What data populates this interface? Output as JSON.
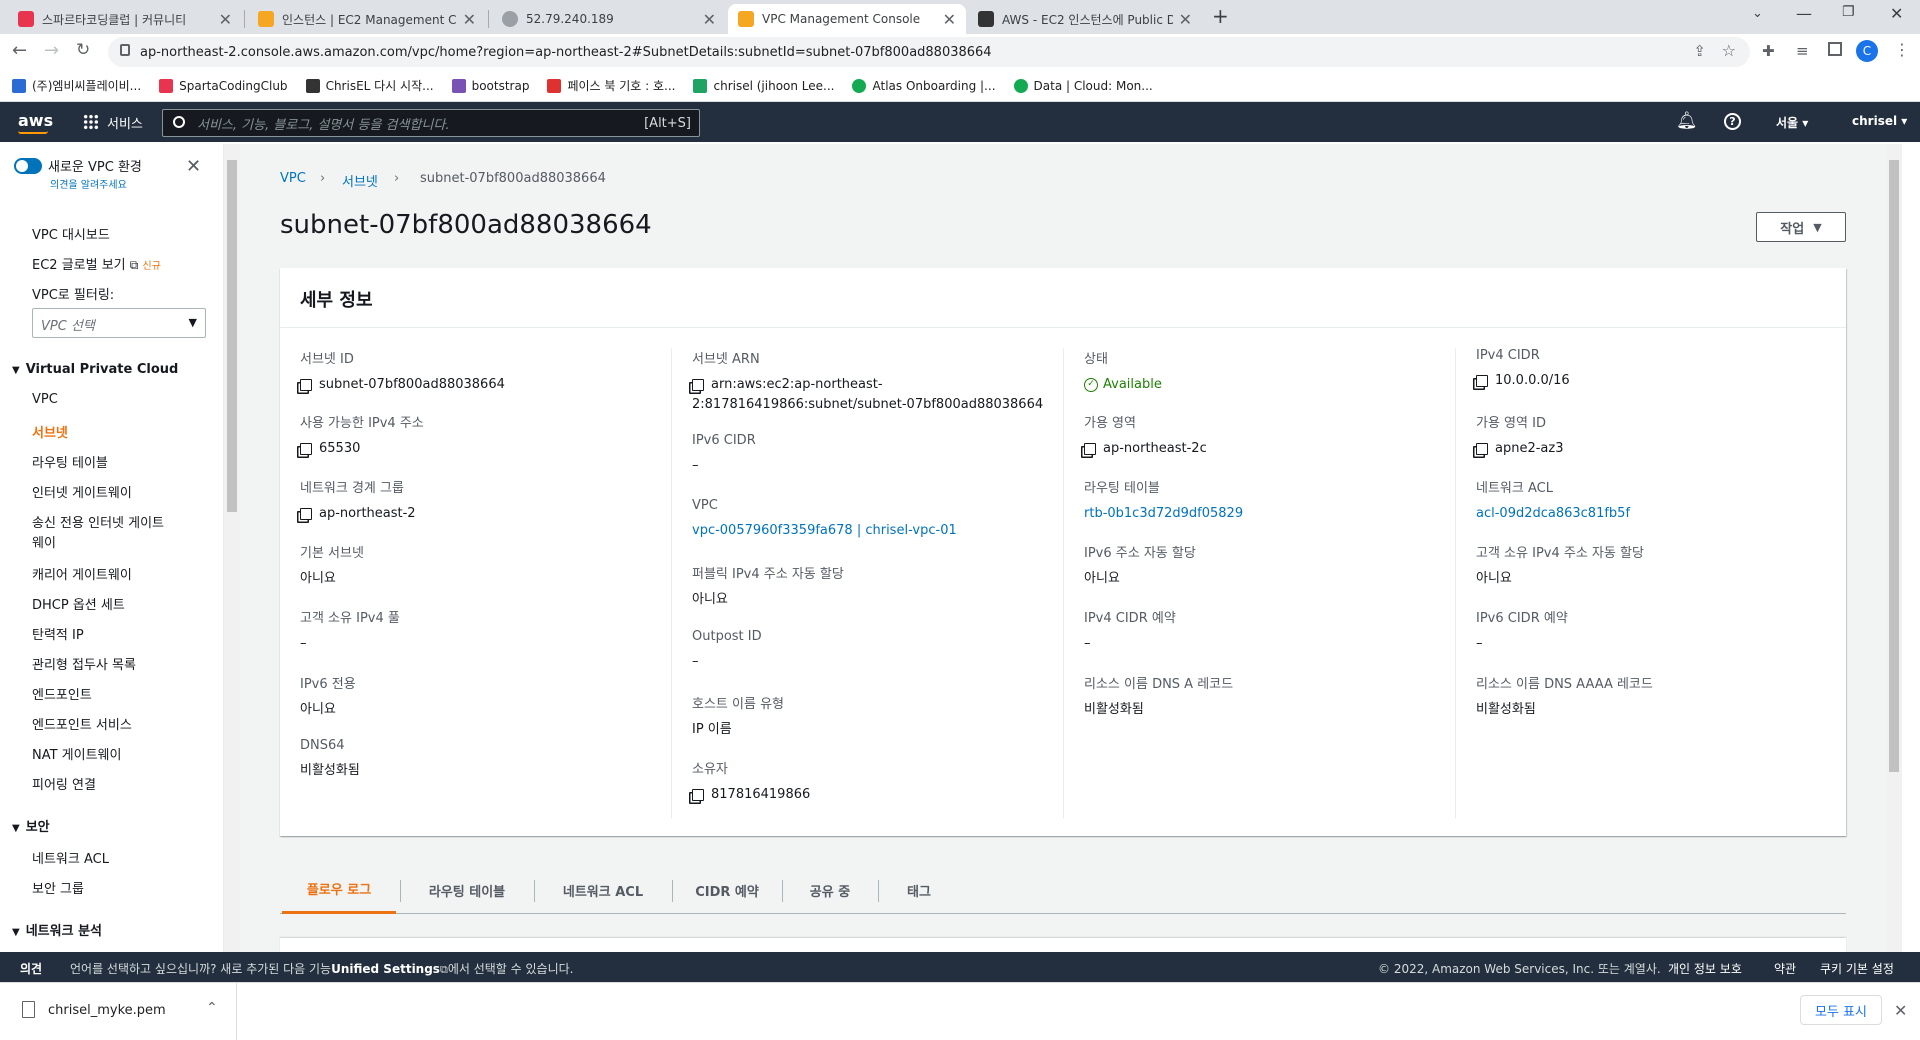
{
  "browser": {
    "tabs": [
      {
        "title": "스파르타코딩클럽 | 커뮤니티",
        "active": false
      },
      {
        "title": "인스턴스 | EC2 Management Co",
        "active": false
      },
      {
        "title": "52.79.240.189",
        "active": false
      },
      {
        "title": "VPC Management Console",
        "active": true
      },
      {
        "title": "AWS - EC2 인스턴스에 Public D",
        "active": false
      }
    ],
    "url": "ap-northeast-2.console.aws.amazon.com/vpc/home?region=ap-northeast-2#SubnetDetails:subnetId=subnet-07bf800ad88038664",
    "bookmarks": [
      {
        "label": "(주)엠비씨플레이비...",
        "color": "#2b6cd4"
      },
      {
        "label": "SpartaCodingClub",
        "color": "#e8344e"
      },
      {
        "label": "ChrisEL 다시 시작...",
        "color": "#333333"
      },
      {
        "label": "bootstrap",
        "color": "#7952b3"
      },
      {
        "label": "페이스 북 기호 : 호...",
        "color": "#e03131"
      },
      {
        "label": "chrisel (jihoon Lee...",
        "color": "#1fa463"
      },
      {
        "label": "Atlas Onboarding |...",
        "color": "#13aa52"
      },
      {
        "label": "Data | Cloud: Mon...",
        "color": "#13aa52"
      }
    ]
  },
  "aws": {
    "logo": "aws",
    "services": "서비스",
    "search_placeholder": "서비스, 기능, 블로그, 설명서 등을 검색합니다.",
    "search_shortcut": "[Alt+S]",
    "region": "서울",
    "user": "chrisel"
  },
  "sidebar": {
    "toggle_title": "새로운 VPC 환경",
    "toggle_sub": "의견을 알려주세요",
    "dashboard": "VPC 대시보드",
    "ec2_global": "EC2 글로벌 보기",
    "new_badge": "신규",
    "filter_label": "VPC로 필터링:",
    "filter_placeholder": "VPC 선택",
    "section_vpc": "Virtual Private Cloud",
    "vpc_items": [
      "VPC",
      "서브넷",
      "라우팅 테이블",
      "인터넷 게이트웨이",
      "송신 전용 인터넷 게이트",
      "웨이",
      "캐리어 게이트웨이",
      "DHCP 옵션 세트",
      "탄력적 IP",
      "관리형 접두사 목록",
      "엔드포인트",
      "엔드포인트 서비스",
      "NAT 게이트웨이",
      "피어링 연결"
    ],
    "section_security": "보안",
    "security_items": [
      "네트워크 ACL",
      "보안 그룹"
    ],
    "section_analysis": "네트워크 분석"
  },
  "breadcrumb": {
    "root": "VPC",
    "section": "서브넷",
    "current": "subnet-07bf800ad88038664"
  },
  "page_title": "subnet-07bf800ad88038664",
  "actions_label": "작업",
  "details": {
    "heading": "세부 정보",
    "col1": [
      {
        "label": "서브넷 ID",
        "value": "subnet-07bf800ad88038664",
        "copy": true
      },
      {
        "label": "사용 가능한 IPv4 주소",
        "value": "65530",
        "copy": true
      },
      {
        "label": "네트워크 경계 그룹",
        "value": "ap-northeast-2",
        "copy": true
      },
      {
        "label": "기본 서브넷",
        "value": "아니요"
      },
      {
        "label": "고객 소유 IPv4 풀",
        "value": "–"
      },
      {
        "label": "IPv6 전용",
        "value": "아니요"
      },
      {
        "label": "DNS64",
        "value": "비활성화됨"
      }
    ],
    "col2": {
      "arn_label": "서브넷 ARN",
      "arn_line1": "arn:aws:ec2:ap-northeast-",
      "arn_line2": "2:817816419866:subnet/subnet-07bf800ad88038664",
      "ipv6cidr_label": "IPv6 CIDR",
      "ipv6cidr_value": "–",
      "vpc_label": "VPC",
      "vpc_value": "vpc-0057960f3359fa678 | chrisel-vpc-01",
      "publicip_label": "퍼블릭 IPv4 주소 자동 할당",
      "publicip_value": "아니요",
      "outpost_label": "Outpost ID",
      "outpost_value": "–",
      "hostname_label": "호스트 이름 유형",
      "hostname_value": "IP 이름",
      "owner_label": "소유자",
      "owner_value": "817816419866"
    },
    "col3": {
      "state_label": "상태",
      "state_value": "Available",
      "az_label": "가용 영역",
      "az_value": "ap-northeast-2c",
      "rt_label": "라우팅 테이블",
      "rt_value": "rtb-0b1c3d72d9df05829",
      "ipv6auto_label": "IPv6 주소 자동 할당",
      "ipv6auto_value": "아니요",
      "ipv4res_label": "IPv4 CIDR 예약",
      "ipv4res_value": "–",
      "dnsa_label": "리소스 이름 DNS A 레코드",
      "dnsa_value": "비활성화됨"
    },
    "col4": {
      "ipv4cidr_label": "IPv4 CIDR",
      "ipv4cidr_value": "10.0.0.0/16",
      "azid_label": "가용 영역 ID",
      "azid_value": "apne2-az3",
      "acl_label": "네트워크 ACL",
      "acl_value": "acl-09d2dca863c81fb5f",
      "custip_label": "고객 소유 IPv4 주소 자동 할당",
      "custip_value": "아니요",
      "ipv6res_label": "IPv6 CIDR 예약",
      "ipv6res_value": "–",
      "dnsaaaa_label": "리소스 이름 DNS AAAA 레코드",
      "dnsaaaa_value": "비활성화됨"
    }
  },
  "detail_tabs": [
    "플로우 로그",
    "라우팅 테이블",
    "네트워크 ACL",
    "CIDR 예약",
    "공유 중",
    "태그"
  ],
  "footer": {
    "feedback": "의견",
    "message_pre": "언어를 선택하고 싶으십니까? 새로 추가된 다음 기능",
    "message_bold": "Unified Settings",
    "message_post": "에서 선택할 수 있습니다.",
    "copyright": "© 2022, Amazon Web Services, Inc. 또는 계열사.",
    "privacy": "개인 정보 보호",
    "terms": "약관",
    "cookies": "쿠키 기본 설정"
  },
  "download": {
    "file": "chrisel_myke.pem",
    "show_all": "모두 표시"
  },
  "colors": {
    "aws_dark": "#232f3e",
    "accent": "#ec7211",
    "link": "#0073bb",
    "ok": "#1d8102"
  }
}
